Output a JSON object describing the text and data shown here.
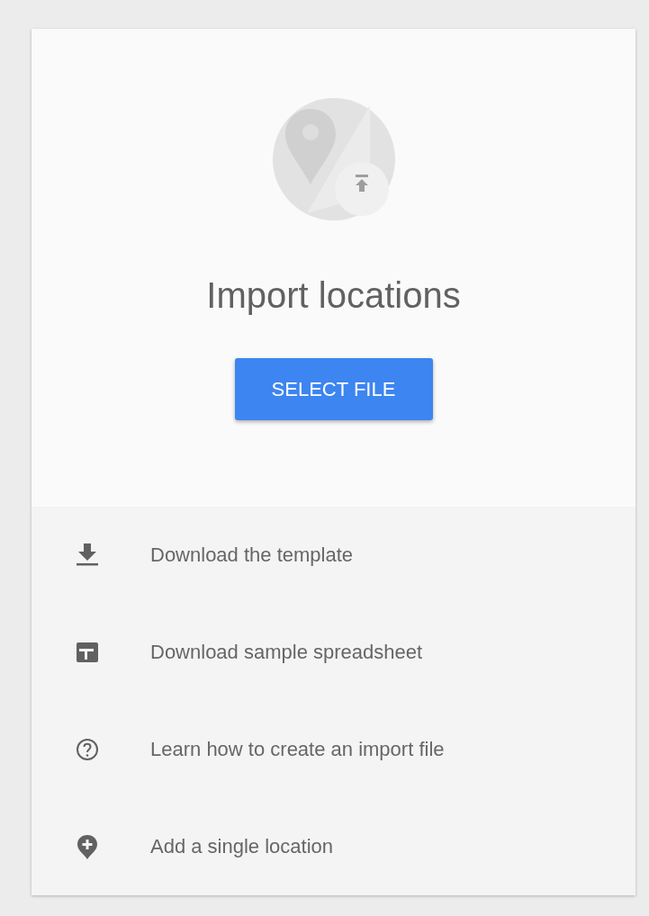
{
  "title": "Import locations",
  "button": {
    "label": "SELECT FILE"
  },
  "options": [
    {
      "kind": "download",
      "label": "Download the template"
    },
    {
      "kind": "spreadsheet",
      "label": "Download sample spreadsheet"
    },
    {
      "kind": "help",
      "label": "Learn how to create an import file"
    },
    {
      "kind": "add-location",
      "label": "Add a single location"
    }
  ]
}
